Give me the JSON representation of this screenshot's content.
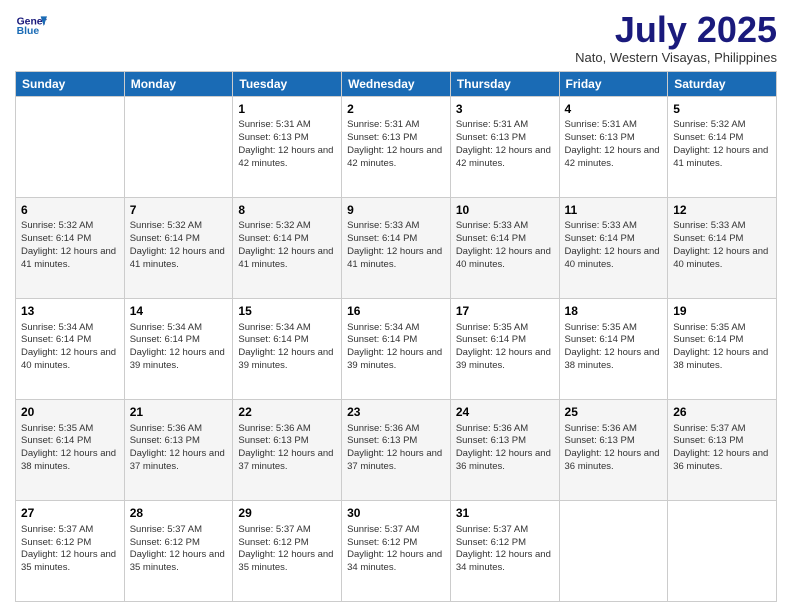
{
  "logo": {
    "line1": "General",
    "line2": "Blue"
  },
  "title": "July 2025",
  "subtitle": "Nato, Western Visayas, Philippines",
  "weekdays": [
    "Sunday",
    "Monday",
    "Tuesday",
    "Wednesday",
    "Thursday",
    "Friday",
    "Saturday"
  ],
  "weeks": [
    [
      {
        "day": "",
        "sunrise": "",
        "sunset": "",
        "daylight": ""
      },
      {
        "day": "",
        "sunrise": "",
        "sunset": "",
        "daylight": ""
      },
      {
        "day": "1",
        "sunrise": "Sunrise: 5:31 AM",
        "sunset": "Sunset: 6:13 PM",
        "daylight": "Daylight: 12 hours and 42 minutes."
      },
      {
        "day": "2",
        "sunrise": "Sunrise: 5:31 AM",
        "sunset": "Sunset: 6:13 PM",
        "daylight": "Daylight: 12 hours and 42 minutes."
      },
      {
        "day": "3",
        "sunrise": "Sunrise: 5:31 AM",
        "sunset": "Sunset: 6:13 PM",
        "daylight": "Daylight: 12 hours and 42 minutes."
      },
      {
        "day": "4",
        "sunrise": "Sunrise: 5:31 AM",
        "sunset": "Sunset: 6:13 PM",
        "daylight": "Daylight: 12 hours and 42 minutes."
      },
      {
        "day": "5",
        "sunrise": "Sunrise: 5:32 AM",
        "sunset": "Sunset: 6:14 PM",
        "daylight": "Daylight: 12 hours and 41 minutes."
      }
    ],
    [
      {
        "day": "6",
        "sunrise": "Sunrise: 5:32 AM",
        "sunset": "Sunset: 6:14 PM",
        "daylight": "Daylight: 12 hours and 41 minutes."
      },
      {
        "day": "7",
        "sunrise": "Sunrise: 5:32 AM",
        "sunset": "Sunset: 6:14 PM",
        "daylight": "Daylight: 12 hours and 41 minutes."
      },
      {
        "day": "8",
        "sunrise": "Sunrise: 5:32 AM",
        "sunset": "Sunset: 6:14 PM",
        "daylight": "Daylight: 12 hours and 41 minutes."
      },
      {
        "day": "9",
        "sunrise": "Sunrise: 5:33 AM",
        "sunset": "Sunset: 6:14 PM",
        "daylight": "Daylight: 12 hours and 41 minutes."
      },
      {
        "day": "10",
        "sunrise": "Sunrise: 5:33 AM",
        "sunset": "Sunset: 6:14 PM",
        "daylight": "Daylight: 12 hours and 40 minutes."
      },
      {
        "day": "11",
        "sunrise": "Sunrise: 5:33 AM",
        "sunset": "Sunset: 6:14 PM",
        "daylight": "Daylight: 12 hours and 40 minutes."
      },
      {
        "day": "12",
        "sunrise": "Sunrise: 5:33 AM",
        "sunset": "Sunset: 6:14 PM",
        "daylight": "Daylight: 12 hours and 40 minutes."
      }
    ],
    [
      {
        "day": "13",
        "sunrise": "Sunrise: 5:34 AM",
        "sunset": "Sunset: 6:14 PM",
        "daylight": "Daylight: 12 hours and 40 minutes."
      },
      {
        "day": "14",
        "sunrise": "Sunrise: 5:34 AM",
        "sunset": "Sunset: 6:14 PM",
        "daylight": "Daylight: 12 hours and 39 minutes."
      },
      {
        "day": "15",
        "sunrise": "Sunrise: 5:34 AM",
        "sunset": "Sunset: 6:14 PM",
        "daylight": "Daylight: 12 hours and 39 minutes."
      },
      {
        "day": "16",
        "sunrise": "Sunrise: 5:34 AM",
        "sunset": "Sunset: 6:14 PM",
        "daylight": "Daylight: 12 hours and 39 minutes."
      },
      {
        "day": "17",
        "sunrise": "Sunrise: 5:35 AM",
        "sunset": "Sunset: 6:14 PM",
        "daylight": "Daylight: 12 hours and 39 minutes."
      },
      {
        "day": "18",
        "sunrise": "Sunrise: 5:35 AM",
        "sunset": "Sunset: 6:14 PM",
        "daylight": "Daylight: 12 hours and 38 minutes."
      },
      {
        "day": "19",
        "sunrise": "Sunrise: 5:35 AM",
        "sunset": "Sunset: 6:14 PM",
        "daylight": "Daylight: 12 hours and 38 minutes."
      }
    ],
    [
      {
        "day": "20",
        "sunrise": "Sunrise: 5:35 AM",
        "sunset": "Sunset: 6:14 PM",
        "daylight": "Daylight: 12 hours and 38 minutes."
      },
      {
        "day": "21",
        "sunrise": "Sunrise: 5:36 AM",
        "sunset": "Sunset: 6:13 PM",
        "daylight": "Daylight: 12 hours and 37 minutes."
      },
      {
        "day": "22",
        "sunrise": "Sunrise: 5:36 AM",
        "sunset": "Sunset: 6:13 PM",
        "daylight": "Daylight: 12 hours and 37 minutes."
      },
      {
        "day": "23",
        "sunrise": "Sunrise: 5:36 AM",
        "sunset": "Sunset: 6:13 PM",
        "daylight": "Daylight: 12 hours and 37 minutes."
      },
      {
        "day": "24",
        "sunrise": "Sunrise: 5:36 AM",
        "sunset": "Sunset: 6:13 PM",
        "daylight": "Daylight: 12 hours and 36 minutes."
      },
      {
        "day": "25",
        "sunrise": "Sunrise: 5:36 AM",
        "sunset": "Sunset: 6:13 PM",
        "daylight": "Daylight: 12 hours and 36 minutes."
      },
      {
        "day": "26",
        "sunrise": "Sunrise: 5:37 AM",
        "sunset": "Sunset: 6:13 PM",
        "daylight": "Daylight: 12 hours and 36 minutes."
      }
    ],
    [
      {
        "day": "27",
        "sunrise": "Sunrise: 5:37 AM",
        "sunset": "Sunset: 6:12 PM",
        "daylight": "Daylight: 12 hours and 35 minutes."
      },
      {
        "day": "28",
        "sunrise": "Sunrise: 5:37 AM",
        "sunset": "Sunset: 6:12 PM",
        "daylight": "Daylight: 12 hours and 35 minutes."
      },
      {
        "day": "29",
        "sunrise": "Sunrise: 5:37 AM",
        "sunset": "Sunset: 6:12 PM",
        "daylight": "Daylight: 12 hours and 35 minutes."
      },
      {
        "day": "30",
        "sunrise": "Sunrise: 5:37 AM",
        "sunset": "Sunset: 6:12 PM",
        "daylight": "Daylight: 12 hours and 34 minutes."
      },
      {
        "day": "31",
        "sunrise": "Sunrise: 5:37 AM",
        "sunset": "Sunset: 6:12 PM",
        "daylight": "Daylight: 12 hours and 34 minutes."
      },
      {
        "day": "",
        "sunrise": "",
        "sunset": "",
        "daylight": ""
      },
      {
        "day": "",
        "sunrise": "",
        "sunset": "",
        "daylight": ""
      }
    ]
  ]
}
